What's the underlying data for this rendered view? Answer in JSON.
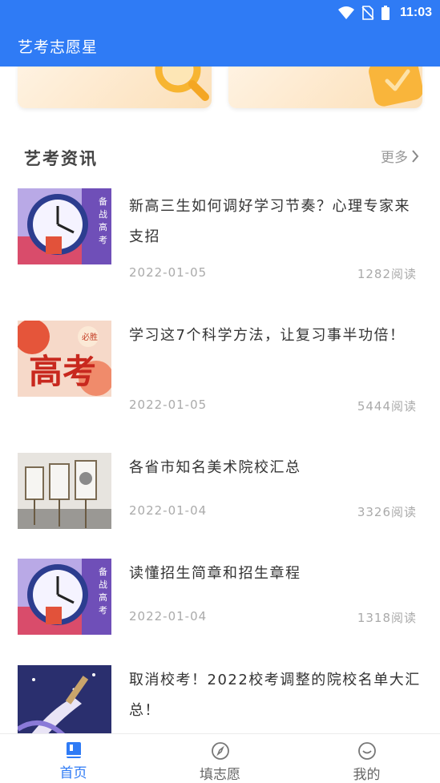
{
  "status": {
    "time": "11:03"
  },
  "appbar": {
    "title": "艺考志愿星"
  },
  "section": {
    "title": "艺考资讯",
    "more_label": "更多"
  },
  "news": [
    {
      "title": "新高三生如何调好学习节奏？心理专家来支招",
      "date": "2022-01-05",
      "reads": "1282阅读",
      "thumb": "clock-poster"
    },
    {
      "title": "学习这7个科学方法，让复习事半功倍！",
      "date": "2022-01-05",
      "reads": "5444阅读",
      "thumb": "gaokao-poster",
      "thumb_text": "高考",
      "thumb_small": "必胜"
    },
    {
      "title": "各省市知名美术院校汇总",
      "date": "2022-01-04",
      "reads": "3326阅读",
      "thumb": "easel-photo"
    },
    {
      "title": "读懂招生简章和招生章程",
      "date": "2022-01-04",
      "reads": "1318阅读",
      "thumb": "clock-poster"
    },
    {
      "title": "取消校考！2022校考调整的院校名单大汇总！",
      "date": "",
      "reads": "",
      "thumb": "brush-poster"
    }
  ],
  "clock_poster_text": "备战高考",
  "tabs": [
    {
      "label": "首页",
      "icon": "book-icon",
      "active": true
    },
    {
      "label": "填志愿",
      "icon": "compass-icon",
      "active": false
    },
    {
      "label": "我的",
      "icon": "smile-icon",
      "active": false
    }
  ],
  "colors": {
    "primary": "#2f7bf5",
    "text": "#333333",
    "muted": "#aaaaaa"
  }
}
